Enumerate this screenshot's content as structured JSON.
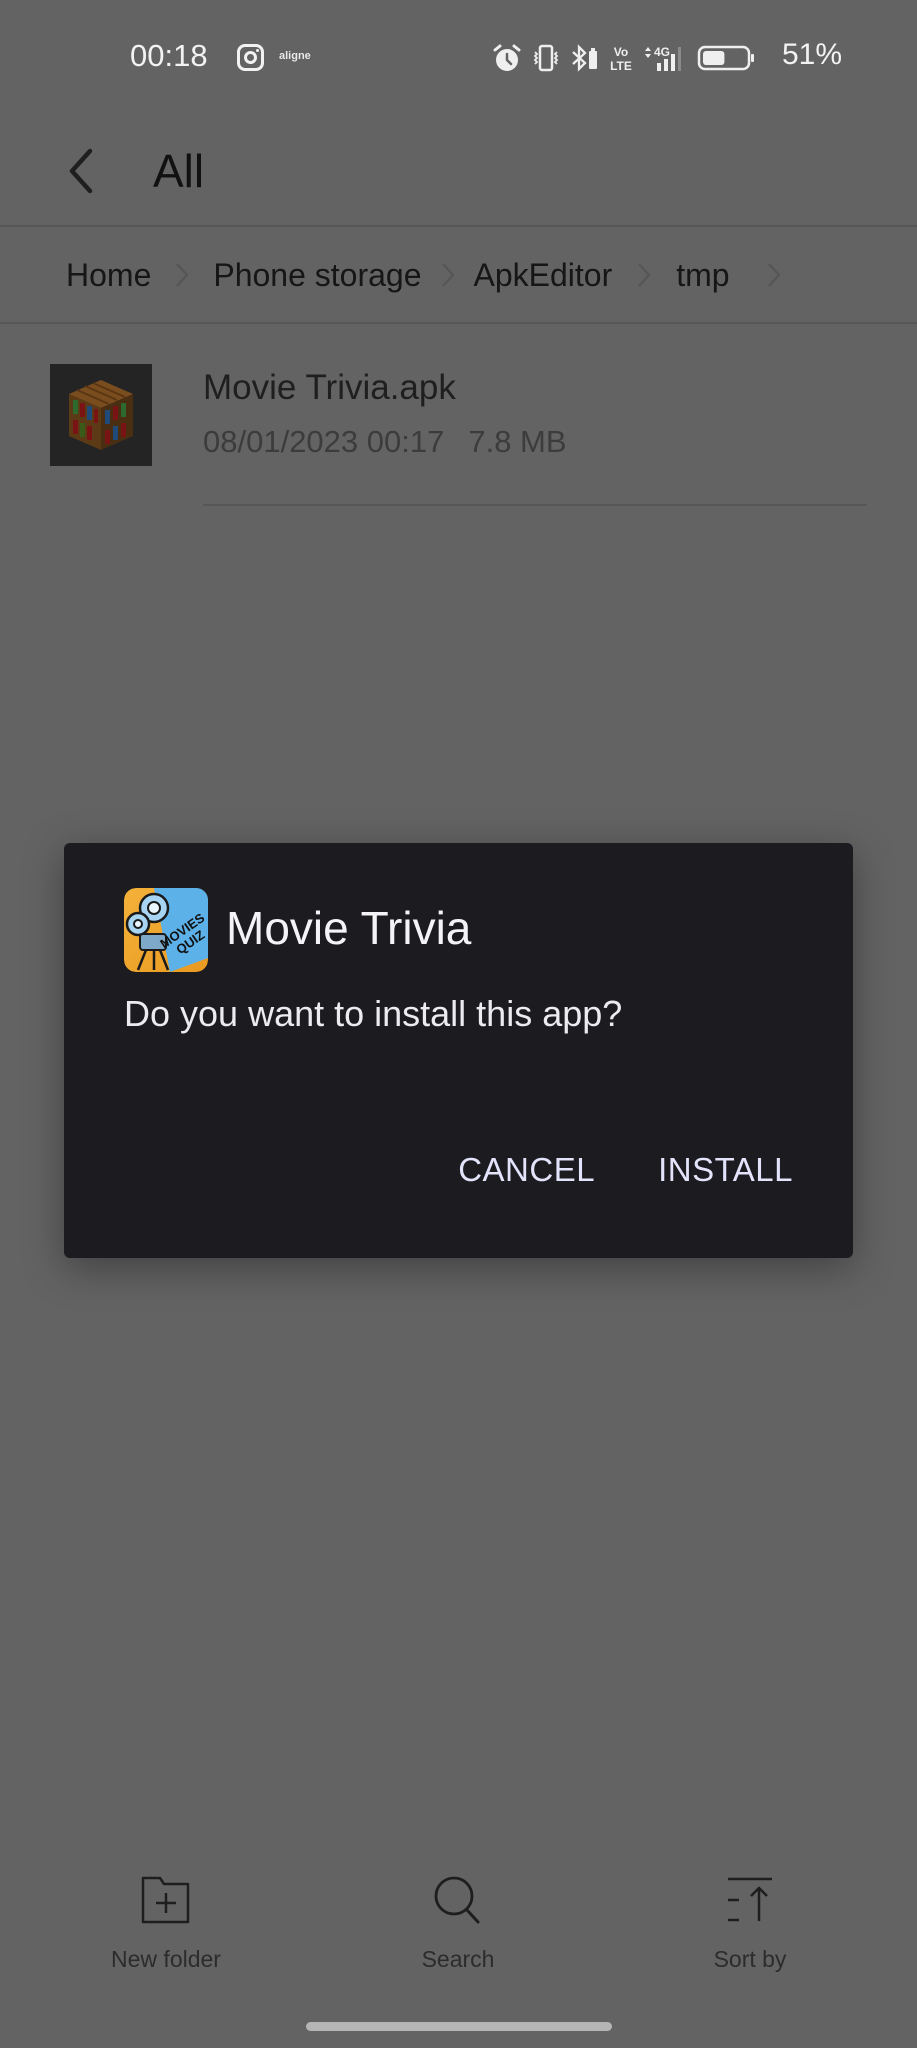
{
  "status_bar": {
    "time": "00:18",
    "notification_app_label": "aligne",
    "icons": [
      "alarm-icon",
      "vibrate-icon",
      "bluetooth-battery-icon",
      "volte-icon",
      "4g-signal-icon",
      "battery-icon"
    ],
    "battery_percent": "51%",
    "battery_level": 0.51,
    "network_type": "4G",
    "volte_top": "Vo",
    "volte_bottom": "LTE"
  },
  "header": {
    "back_icon": "chevron-left-icon",
    "title": "All"
  },
  "breadcrumb": {
    "items": [
      "Home",
      "Phone storage",
      "ApkEditor",
      "tmp"
    ]
  },
  "files": [
    {
      "name": "Movie Trivia.apk",
      "date": "08/01/2023 00:17",
      "size": "7.8 MB",
      "icon": "apk-bookshelf-icon"
    }
  ],
  "dialog": {
    "app_name": "Movie Trivia",
    "app_icon": "movies-quiz-icon",
    "app_icon_text_1": "MOVIES",
    "app_icon_text_2": "QUIZ",
    "message": "Do you want to install this app?",
    "cancel_label": "CANCEL",
    "install_label": "INSTALL"
  },
  "toolbar": {
    "items": [
      {
        "label": "New folder",
        "icon": "new-folder-icon"
      },
      {
        "label": "Search",
        "icon": "search-icon"
      },
      {
        "label": "Sort by",
        "icon": "sort-icon"
      }
    ]
  },
  "colors": {
    "scrim_background": "#636363",
    "dialog_background": "#1c1b20",
    "dialog_button_text": "#e3e4fb"
  }
}
